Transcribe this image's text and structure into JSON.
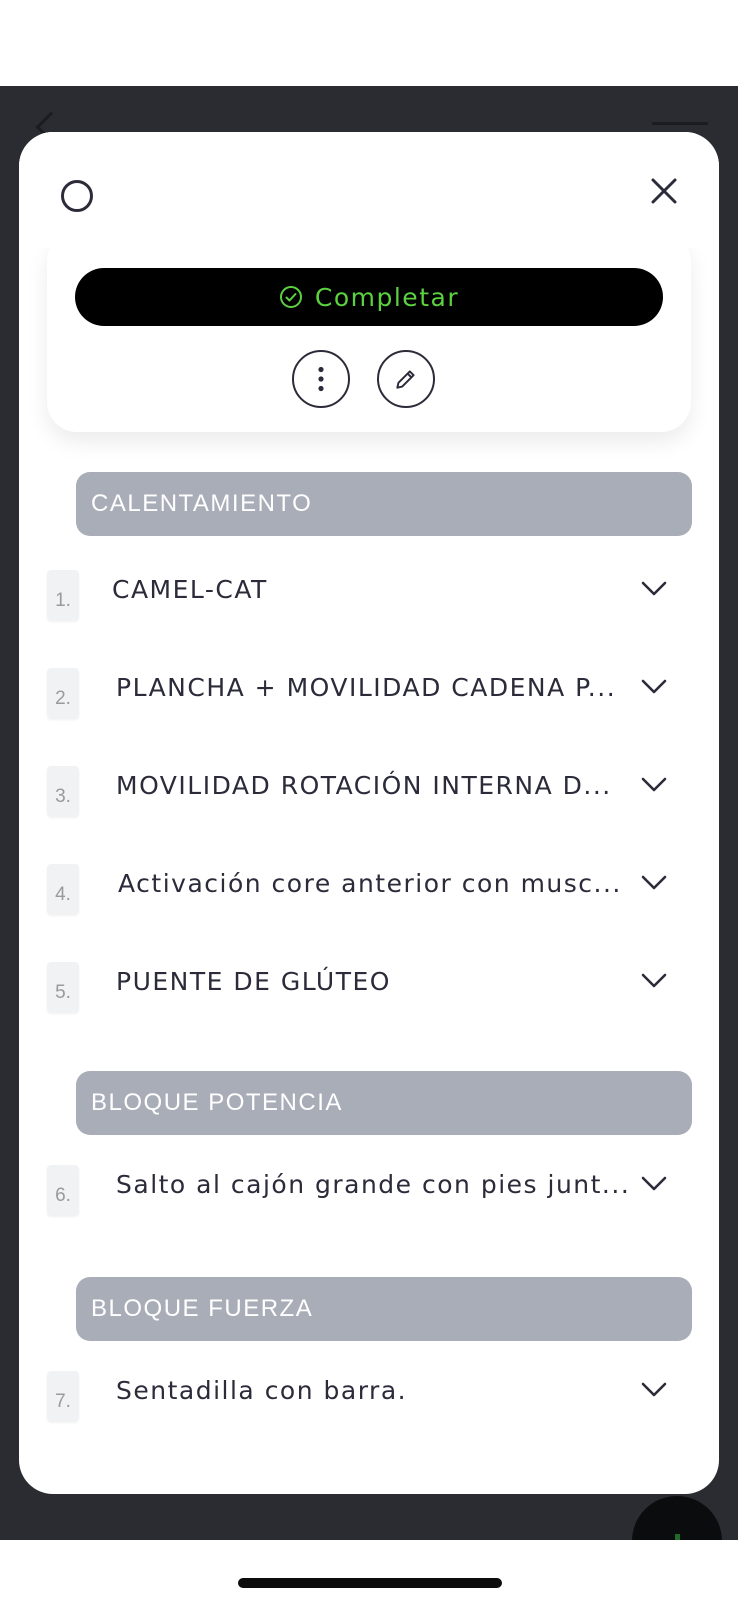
{
  "modal": {
    "complete_label": "Completar",
    "sections": [
      {
        "title": "CALENTAMIENTO",
        "exercises": [
          {
            "number": "1.",
            "name": "CAMEL-CAT"
          },
          {
            "number": "2.",
            "name": "PLANCHA + MOVILIDAD CADENA P..."
          },
          {
            "number": "3.",
            "name": "MOVILIDAD ROTACIÓN INTERNA D..."
          },
          {
            "number": "4.",
            "name": "Activación core anterior con musc..."
          },
          {
            "number": "5.",
            "name": "PUENTE DE GLÚTEO"
          }
        ]
      },
      {
        "title": "BLOQUE POTENCIA",
        "exercises": [
          {
            "number": "6.",
            "name": "Salto al cajón grande con pies junt..."
          }
        ]
      },
      {
        "title": "BLOQUE FUERZA",
        "exercises": [
          {
            "number": "7.",
            "name": "Sentadilla con barra."
          }
        ]
      }
    ]
  },
  "icons": {
    "status": "circle-outline-icon",
    "close": "close-icon",
    "complete": "check-circle-icon",
    "more": "more-vertical-icon",
    "edit": "pencil-icon",
    "expand": "chevron-down-icon"
  },
  "colors": {
    "complete_button_bg": "#000000",
    "complete_text": "#5bd140",
    "section_header_bg": "#a9adb8",
    "backdrop": "#2b2c31"
  }
}
